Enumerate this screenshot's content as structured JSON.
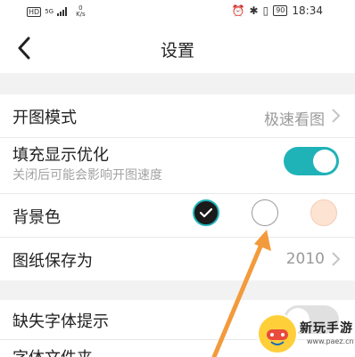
{
  "status_bar": {
    "hd": "HD",
    "signal": "5G",
    "speed_value": "0",
    "speed_unit": "K/s",
    "battery": "90",
    "time": "18:34"
  },
  "nav": {
    "title": "设置"
  },
  "settings": {
    "open_mode": {
      "label": "开图模式",
      "value": "极速看图"
    },
    "fill_display": {
      "label": "填充显示优化",
      "sub": "关闭后可能会影响开图速度",
      "enabled": true
    },
    "background": {
      "label": "背景色",
      "options": [
        "#1a1a1a",
        "#ffffff",
        "#fde3d2"
      ],
      "selected_index": 0
    },
    "save_as": {
      "label": "图纸保存为",
      "value": "2010"
    },
    "missing_font": {
      "label": "缺失字体提示",
      "enabled": false
    },
    "font_folder": {
      "label": "字体文件夹"
    }
  },
  "watermark": {
    "brand": "新玩手游",
    "url": "www.paez.cn"
  },
  "colors": {
    "accent": "#1fb3b8",
    "arrow": "#f39a3c"
  }
}
